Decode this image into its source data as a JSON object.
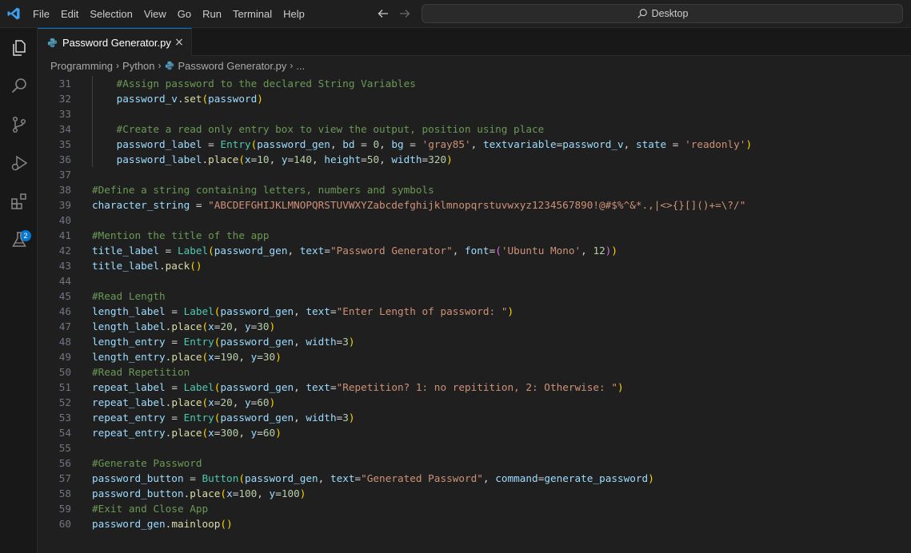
{
  "menu": [
    "File",
    "Edit",
    "Selection",
    "View",
    "Go",
    "Run",
    "Terminal",
    "Help"
  ],
  "search": {
    "label": "Desktop"
  },
  "tab": {
    "label": "Password Generator.py",
    "close": "×"
  },
  "breadcrumb": {
    "items": [
      "Programming",
      "Python",
      "Password Generator.py",
      "..."
    ]
  },
  "extensions_badge": "2",
  "colors": {
    "accent": "#0078d4",
    "background": "#1f1f1f",
    "sidebar": "#181818"
  },
  "icons": [
    "vscode-logo-icon",
    "arrow-left-icon",
    "arrow-right-icon",
    "search-icon",
    "explorer-icon",
    "search-view-icon",
    "source-control-icon",
    "run-debug-icon",
    "extensions-icon",
    "testing-icon",
    "python-file-icon",
    "close-icon",
    "chevron-right-icon"
  ],
  "code_lines": [
    {
      "n": "31",
      "text": "    #Assign password to the declared String Variables"
    },
    {
      "n": "32",
      "text": "    password_v.set(password)"
    },
    {
      "n": "33",
      "text": ""
    },
    {
      "n": "34",
      "text": "    #Create a read only entry box to view the output, position using place"
    },
    {
      "n": "35",
      "text": "    password_label = Entry(password_gen, bd = 0, bg = 'gray85', textvariable=password_v, state = 'readonly')"
    },
    {
      "n": "36",
      "text": "    password_label.place(x=10, y=140, height=50, width=320)"
    },
    {
      "n": "37",
      "text": ""
    },
    {
      "n": "38",
      "text": "#Define a string containing letters, numbers and symbols"
    },
    {
      "n": "39",
      "text": "character_string = \"ABCDEFGHIJKLMNOPQRSTUVWXYZabcdefghijklmnopqrstuvwxyz1234567890!@#$%^&*.,|<>{}[]()+=\\?/\""
    },
    {
      "n": "40",
      "text": ""
    },
    {
      "n": "41",
      "text": "#Mention the title of the app"
    },
    {
      "n": "42",
      "text": "title_label = Label(password_gen, text=\"Password Generator\", font=('Ubuntu Mono', 12))"
    },
    {
      "n": "43",
      "text": "title_label.pack()"
    },
    {
      "n": "44",
      "text": ""
    },
    {
      "n": "45",
      "text": "#Read Length"
    },
    {
      "n": "46",
      "text": "length_label = Label(password_gen, text=\"Enter Length of password: \")"
    },
    {
      "n": "47",
      "text": "length_label.place(x=20, y=30)"
    },
    {
      "n": "48",
      "text": "length_entry = Entry(password_gen, width=3)"
    },
    {
      "n": "49",
      "text": "length_entry.place(x=190, y=30)"
    },
    {
      "n": "50",
      "text": "#Read Repetition"
    },
    {
      "n": "51",
      "text": "repeat_label = Label(password_gen, text=\"Repetition? 1: no repitition, 2: Otherwise: \")"
    },
    {
      "n": "52",
      "text": "repeat_label.place(x=20, y=60)"
    },
    {
      "n": "53",
      "text": "repeat_entry = Entry(password_gen, width=3)"
    },
    {
      "n": "54",
      "text": "repeat_entry.place(x=300, y=60)"
    },
    {
      "n": "55",
      "text": ""
    },
    {
      "n": "56",
      "text": "#Generate Password"
    },
    {
      "n": "57",
      "text": "password_button = Button(password_gen, text=\"Generated Password\", command=generate_password)"
    },
    {
      "n": "58",
      "text": "password_button.place(x=100, y=100)"
    },
    {
      "n": "59",
      "text": "#Exit and Close App"
    },
    {
      "n": "60",
      "text": "password_gen.mainloop()"
    }
  ]
}
